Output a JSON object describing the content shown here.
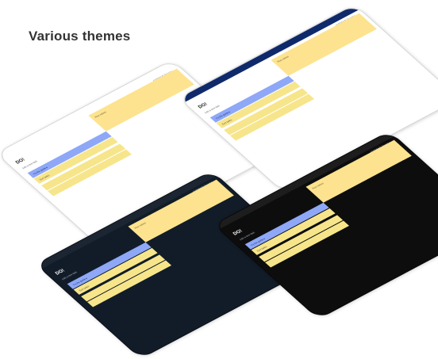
{
  "title": "Various themes",
  "tablets": [
    {
      "top_info": "OVERDUE Project ▸",
      "logo": "DO!",
      "new_task": "Add a new task",
      "rows": [
        "Try the guide  ▸",
        "Sort tasks",
        "",
        ""
      ],
      "note": "Row values"
    },
    {
      "top_info": "OVERDUE Project ▸",
      "logo": "DO!",
      "new_task": "Add a new task",
      "rows": [
        "Try the guide  ▸",
        "Sort tasks",
        "",
        ""
      ],
      "note": "Row values"
    },
    {
      "top_info": "OVERDUE Project ▸",
      "logo": "DO!",
      "new_task": "Add a new task",
      "rows": [
        "Try the guide  ▸",
        "Sort tasks",
        "",
        ""
      ],
      "note": "Row values"
    },
    {
      "top_info": "OVERDUE Project ▸",
      "logo": "DO!",
      "new_task": "Add a new task",
      "rows": [
        "Try the guide  ▸",
        "Sort tasks",
        "",
        ""
      ],
      "note": "Row values"
    }
  ]
}
